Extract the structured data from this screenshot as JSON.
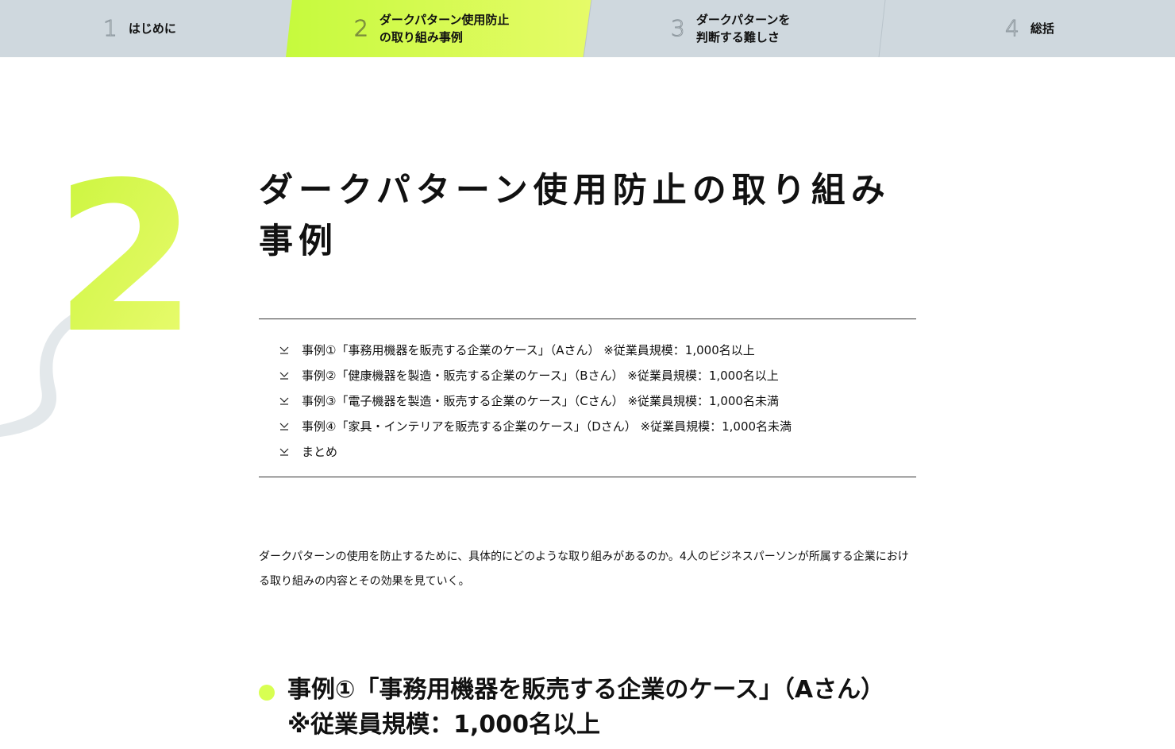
{
  "colors": {
    "nav_background": "#cfd8de",
    "nav_active_start": "#c6fa3d",
    "nav_active_end": "#e6fb68",
    "accent_lime": "#d8ff52",
    "text": "#111111",
    "rule": "#333333",
    "numeral_shadow": "#e3e8eb"
  },
  "steps": [
    {
      "number": "1",
      "label": "はじめに",
      "active": false
    },
    {
      "number": "2",
      "label": "ダークパターン使用防止\nの取り組み事例",
      "active": true
    },
    {
      "number": "3",
      "label": "ダークパターンを\n判断する難しさ",
      "active": false
    },
    {
      "number": "4",
      "label": "総括",
      "active": false
    }
  ],
  "section_number": "2",
  "page_title": "ダークパターン使用防止の取り組み事例",
  "toc": {
    "icon": "chevron-down-underline-icon",
    "items": [
      "事例①「事務用機器を販売する企業のケース」（Aさん） ※従業員規模：1,000名以上",
      "事例②「健康機器を製造・販売する企業のケース」（Bさん） ※従業員規模：1,000名以上",
      "事例③「電子機器を製造・販売する企業のケース」（Cさん） ※従業員規模：1,000名未満",
      "事例④「家具・インテリアを販売する企業のケース」（Dさん） ※従業員規模：1,000名未満",
      "まとめ"
    ]
  },
  "intro": "ダークパターンの使用を防止するために、具体的にどのような取り組みがあるのか。4人のビジネスパーソンが所属する企業における取り組みの内容とその効果を見ていく。",
  "section_heading": "事例①「事務用機器を販売する企業のケース」（Aさん） ※従業員規模：1,000名以上"
}
